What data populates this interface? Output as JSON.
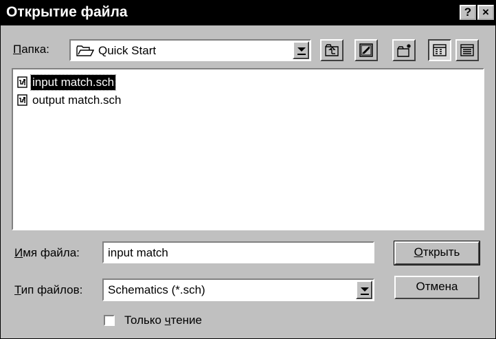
{
  "window": {
    "title": "Открытие файла",
    "help_glyph": "?",
    "close_glyph": "×"
  },
  "folder": {
    "label_access": "П",
    "label_rest": "апка:",
    "value": "Quick Start",
    "icons": [
      "folder-icon",
      "up-one-level-icon",
      "desktop-icon",
      "new-folder-icon",
      "list-view-icon",
      "details-view-icon"
    ]
  },
  "files": [
    {
      "name": "input match.sch",
      "selected": true
    },
    {
      "name": "output match.sch",
      "selected": false
    }
  ],
  "filename": {
    "label_access": "И",
    "label_rest": "мя файла:",
    "value": "input match"
  },
  "filetype": {
    "label_access": "Т",
    "label_rest": "ип файлов:",
    "value": "Schematics (*.sch)"
  },
  "readonly": {
    "label_pre": "Только ",
    "label_access": "ч",
    "label_rest": "тение",
    "checked": false
  },
  "buttons": {
    "open_access": "О",
    "open_rest": "ткрыть",
    "cancel": "Отмена"
  }
}
